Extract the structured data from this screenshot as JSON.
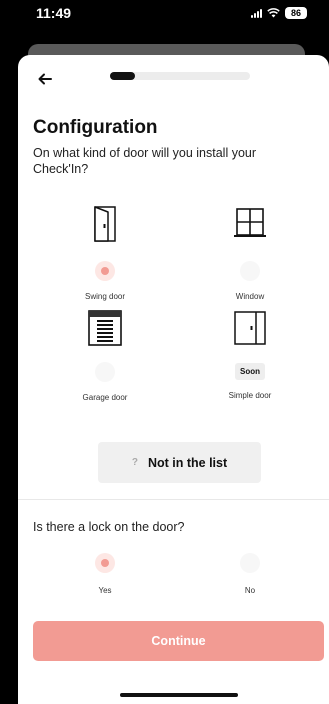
{
  "status": {
    "time": "11:49",
    "battery": "86"
  },
  "progress": {
    "fraction": 0.18
  },
  "header": {
    "title": "Configuration",
    "subtitle": "On what kind of door will you install your Check'In?"
  },
  "door_options": [
    {
      "label": "Swing door",
      "icon": "swing-door-icon",
      "selected": true
    },
    {
      "label": "Window",
      "icon": "window-icon",
      "selected": false
    },
    {
      "label": "Garage door",
      "icon": "garage-door-icon",
      "selected": false
    },
    {
      "label": "Simple door",
      "icon": "simple-door-icon",
      "badge": "Soon"
    }
  ],
  "not_in_list": {
    "icon": "?",
    "label": "Not in the list"
  },
  "lock": {
    "question": "Is there a lock on the door?",
    "options": [
      {
        "label": "Yes",
        "selected": true
      },
      {
        "label": "No",
        "selected": false
      }
    ]
  },
  "continue_label": "Continue",
  "colors": {
    "accent": "#f29b93"
  }
}
